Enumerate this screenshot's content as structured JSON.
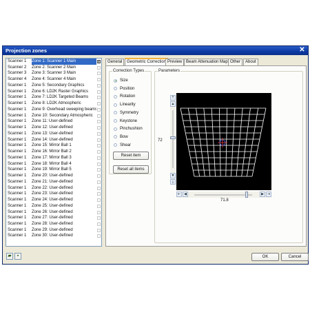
{
  "window": {
    "title": "Projection zones"
  },
  "zones": [
    {
      "scanner": "Scanner 1",
      "zone": "Zone 1: Scanner 1 Main",
      "selected": true
    },
    {
      "scanner": "Scanner 2",
      "zone": "Zone 2: Scanner 2 Main"
    },
    {
      "scanner": "Scanner 3",
      "zone": "Zone 3: Scanner 3 Main"
    },
    {
      "scanner": "Scanner 4",
      "zone": "Zone 4: Scanner 4 Main"
    },
    {
      "scanner": "Scanner 1",
      "zone": "Zone 5: Secondary Graphics"
    },
    {
      "scanner": "Scanner 1",
      "zone": "Zone 6: LD2K Raster Graphics"
    },
    {
      "scanner": "Scanner 1",
      "zone": "Zone 7: LD2K Targeted Beams"
    },
    {
      "scanner": "Scanner 1",
      "zone": "Zone 8: LD2K Atmospheric"
    },
    {
      "scanner": "Scanner 1",
      "zone": "Zone 9: Overhead sweeping beams"
    },
    {
      "scanner": "Scanner 1",
      "zone": "Zone 10: Secondary Atmospheric"
    },
    {
      "scanner": "Scanner 1",
      "zone": "Zone 11: User-defined"
    },
    {
      "scanner": "Scanner 1",
      "zone": "Zone 12: User-defined"
    },
    {
      "scanner": "Scanner 1",
      "zone": "Zone 13: User-defined"
    },
    {
      "scanner": "Scanner 1",
      "zone": "Zone 14: User-defined"
    },
    {
      "scanner": "Scanner 1",
      "zone": "Zone 15: Mirror Ball 1"
    },
    {
      "scanner": "Scanner 1",
      "zone": "Zone 16: Mirror Ball 2"
    },
    {
      "scanner": "Scanner 1",
      "zone": "Zone 17: Mirror Ball 3"
    },
    {
      "scanner": "Scanner 1",
      "zone": "Zone 18: Mirror Ball 4"
    },
    {
      "scanner": "Scanner 1",
      "zone": "Zone 19: Mirror Ball 5"
    },
    {
      "scanner": "Scanner 1",
      "zone": "Zone 20: User-defined"
    },
    {
      "scanner": "Scanner 1",
      "zone": "Zone 21: User-defined"
    },
    {
      "scanner": "Scanner 1",
      "zone": "Zone 22: User-defined"
    },
    {
      "scanner": "Scanner 1",
      "zone": "Zone 23: User-defined"
    },
    {
      "scanner": "Scanner 1",
      "zone": "Zone 24: User-defined"
    },
    {
      "scanner": "Scanner 1",
      "zone": "Zone 25: User-defined"
    },
    {
      "scanner": "Scanner 1",
      "zone": "Zone 26: User-defined"
    },
    {
      "scanner": "Scanner 1",
      "zone": "Zone 27: User-defined"
    },
    {
      "scanner": "Scanner 1",
      "zone": "Zone 28: User-defined"
    },
    {
      "scanner": "Scanner 1",
      "zone": "Zone 29: User-defined"
    },
    {
      "scanner": "Scanner 1",
      "zone": "Zone 30: User-defined"
    }
  ],
  "tabs": [
    {
      "label": "General"
    },
    {
      "label": "Geometric Correction",
      "active": true
    },
    {
      "label": "Preview"
    },
    {
      "label": "Beam Attenuation Map"
    },
    {
      "label": "Other"
    },
    {
      "label": "About"
    }
  ],
  "correction": {
    "group_label": "Correction Types",
    "types": [
      "Size",
      "Position",
      "Rotation",
      "Linearity",
      "Symmetry",
      "Keystone",
      "Pinchushion",
      "Bow",
      "Shear"
    ],
    "selected": "Size",
    "reset_item": "Reset item",
    "reset_all": "Reset all items"
  },
  "parameters": {
    "group_label": "Parameters",
    "vertical_value": "72",
    "horizontal_value": "71.8"
  },
  "footer": {
    "ok": "OK",
    "cancel": "Cancel"
  },
  "icons": {
    "close": "close-icon",
    "open_folder": "open-folder-icon",
    "save": "save-icon",
    "grid": "grid-icon"
  },
  "colors": {
    "titlebar": "#0d3aa3",
    "selection": "#3169c6",
    "grid_lines": "#ffffff",
    "display_bg": "#000000"
  }
}
